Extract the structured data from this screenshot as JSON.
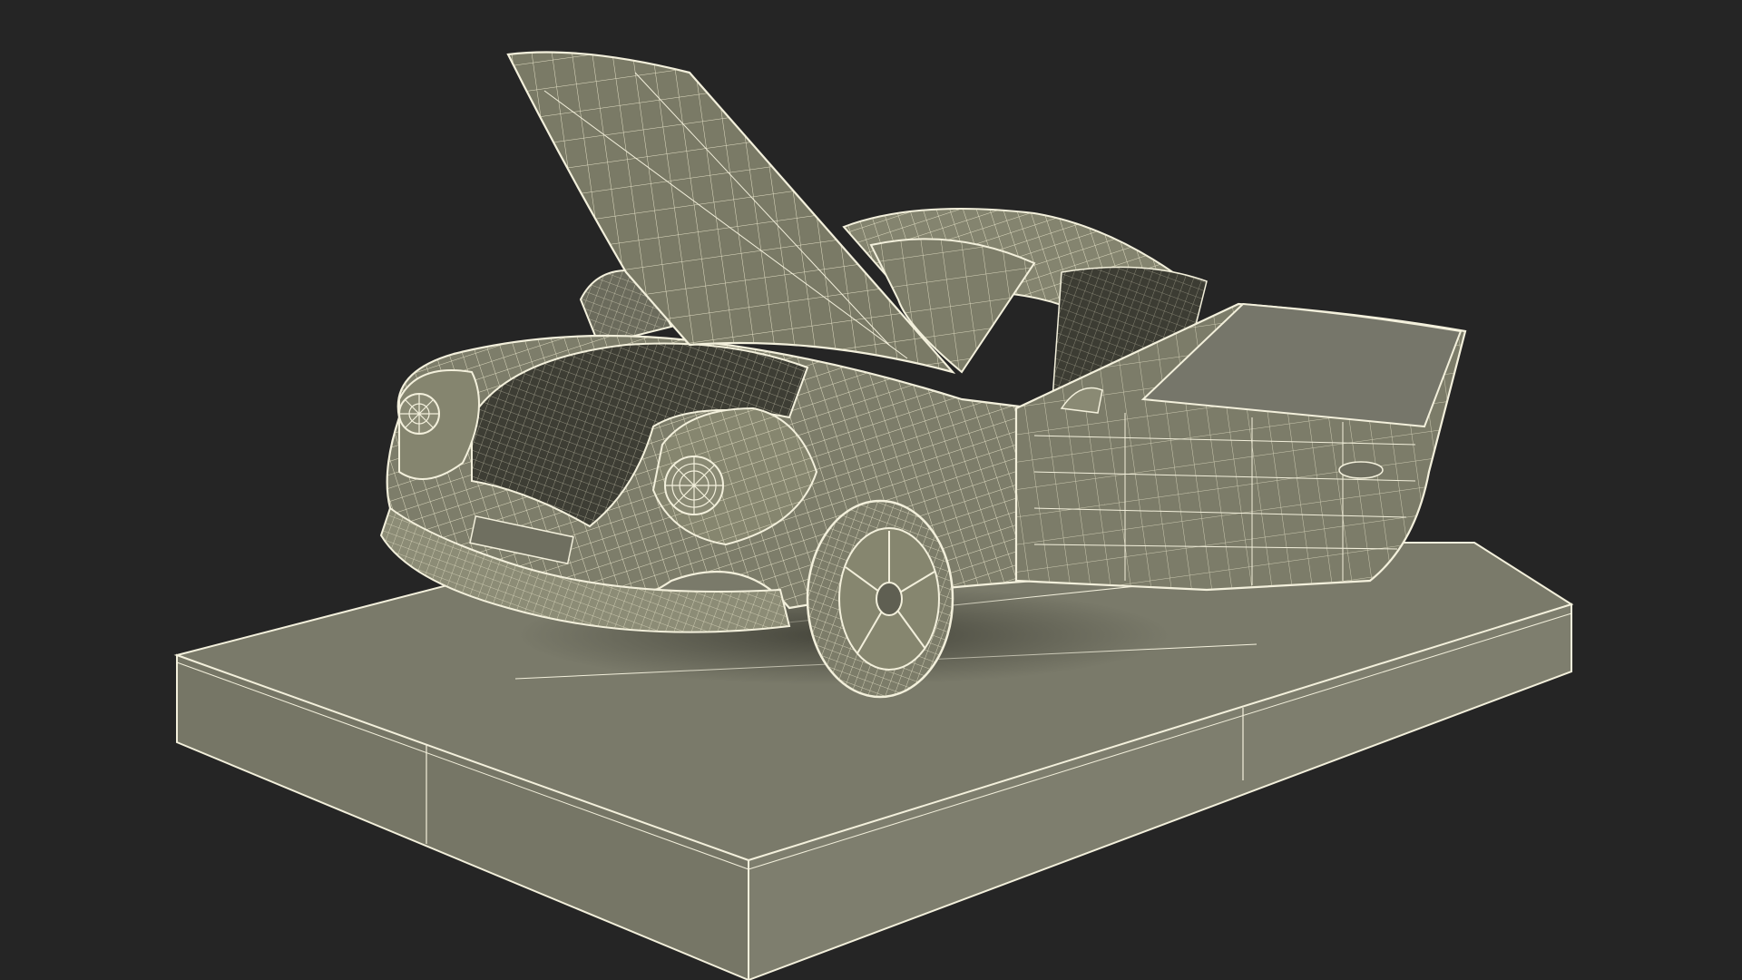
{
  "scene": {
    "background_color": "#252525",
    "surface_color": "#7a7a6a",
    "surface_dark_color": "#5f5f52",
    "wire_color": "#f3f0dc",
    "subject": "wireframe-car-on-pedestal"
  }
}
